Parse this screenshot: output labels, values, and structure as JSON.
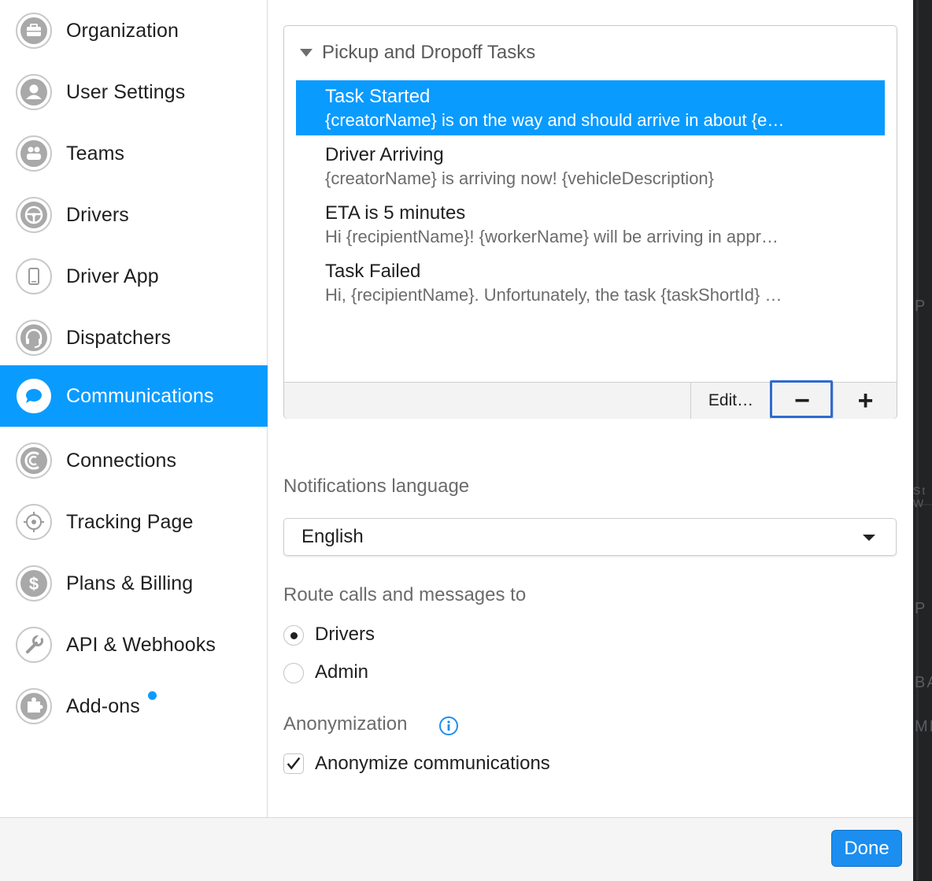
{
  "sidebar": {
    "items": [
      {
        "label": "Organization",
        "icon": "briefcase-icon"
      },
      {
        "label": "User Settings",
        "icon": "user-icon"
      },
      {
        "label": "Teams",
        "icon": "team-icon"
      },
      {
        "label": "Drivers",
        "icon": "steering-wheel-icon"
      },
      {
        "label": "Driver App",
        "icon": "phone-icon"
      },
      {
        "label": "Dispatchers",
        "icon": "headset-icon"
      },
      {
        "label": "Communications",
        "icon": "chat-bubble-icon",
        "active": true
      },
      {
        "label": "Connections",
        "icon": "connections-icon"
      },
      {
        "label": "Tracking Page",
        "icon": "target-icon"
      },
      {
        "label": "Plans & Billing",
        "icon": "dollar-icon"
      },
      {
        "label": "API & Webhooks",
        "icon": "wrench-icon"
      },
      {
        "label": "Add-ons",
        "icon": "puzzle-icon",
        "has_dot": true
      }
    ]
  },
  "tasks": {
    "group": "Pickup and Dropoff Tasks",
    "items": [
      {
        "title": "Task Started",
        "subtitle": "{creatorName} is on the way and should arrive in about {e…",
        "selected": true
      },
      {
        "title": "Driver Arriving",
        "subtitle": "{creatorName} is arriving now! {vehicleDescription}"
      },
      {
        "title": "ETA is 5 minutes",
        "subtitle": "Hi {recipientName}! {workerName} will be arriving in appr…"
      },
      {
        "title": "Task Failed",
        "subtitle": "Hi, {recipientName}. Unfortunately, the task {taskShortId} …"
      }
    ],
    "toolbar": {
      "edit_label": "Edit…",
      "remove_label": "−",
      "add_label": "+"
    }
  },
  "notifications_language": {
    "label": "Notifications language",
    "value": "English"
  },
  "route": {
    "label": "Route calls and messages to",
    "options": [
      {
        "label": "Drivers",
        "checked": true
      },
      {
        "label": "Admin",
        "checked": false
      }
    ]
  },
  "anonymization": {
    "label": "Anonymization",
    "checkbox_label": "Anonymize communications",
    "checked": true
  },
  "footer": {
    "done_label": "Done"
  },
  "colors": {
    "accent": "#0a9bff",
    "focus": "#2f6bd0",
    "done": "#1b8ef0"
  }
}
